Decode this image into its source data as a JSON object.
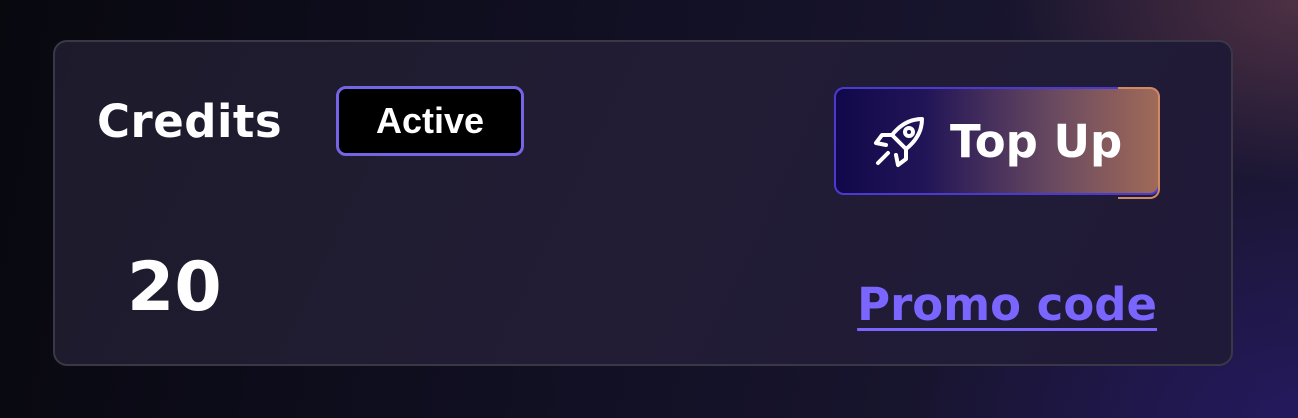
{
  "card": {
    "title": "Credits",
    "status_badge": "Active",
    "amount": "20"
  },
  "actions": {
    "top_up_label": "Top Up",
    "top_up_icon": "rocket-icon",
    "promo_label": "Promo code"
  },
  "colors": {
    "accent": "#7565e6",
    "promo_link": "#7a66ff"
  }
}
